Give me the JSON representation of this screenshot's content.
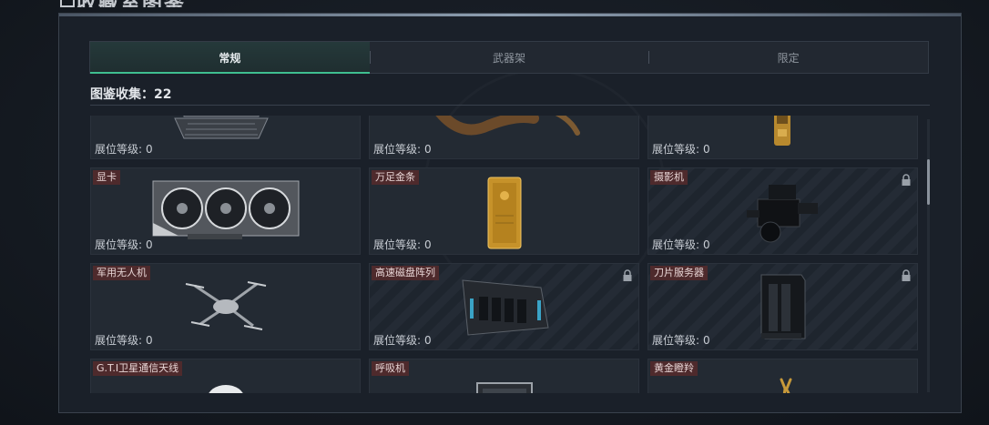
{
  "page": {
    "title": "收藏室图鉴"
  },
  "tabs": [
    {
      "label": "常规",
      "active": true
    },
    {
      "label": "武器架",
      "active": false
    },
    {
      "label": "限定",
      "active": false
    }
  ],
  "collection": {
    "label": "图鉴收集：22"
  },
  "level_label": "展位等级:",
  "items": [
    {
      "name": "",
      "level": "0",
      "locked": false,
      "icon": "laptop-icon"
    },
    {
      "name": "",
      "level": "0",
      "locked": false,
      "icon": "horn-icon"
    },
    {
      "name": "",
      "level": "0",
      "locked": false,
      "icon": "gold-bottle-icon"
    },
    {
      "name": "显卡",
      "level": "0",
      "locked": false,
      "icon": "graphics-card-icon"
    },
    {
      "name": "万足金条",
      "level": "0",
      "locked": false,
      "icon": "gold-bar-icon"
    },
    {
      "name": "摄影机",
      "level": "0",
      "locked": true,
      "icon": "camera-icon"
    },
    {
      "name": "军用无人机",
      "level": "0",
      "locked": false,
      "icon": "drone-icon"
    },
    {
      "name": "高速磁盘阵列",
      "level": "0",
      "locked": true,
      "icon": "disk-array-icon"
    },
    {
      "name": "刀片服务器",
      "level": "0",
      "locked": true,
      "icon": "blade-server-icon"
    },
    {
      "name": "G.T.I卫星通信天线",
      "level": "",
      "locked": false,
      "icon": "antenna-icon"
    },
    {
      "name": "呼吸机",
      "level": "",
      "locked": false,
      "icon": "ventilator-icon"
    },
    {
      "name": "黄金瞪羚",
      "level": "",
      "locked": false,
      "icon": "gold-gazelle-icon"
    }
  ],
  "colors": {
    "accent": "#3fbf90",
    "tag_bg": "#4e2a2c",
    "panel_bg": "#1a2029"
  }
}
